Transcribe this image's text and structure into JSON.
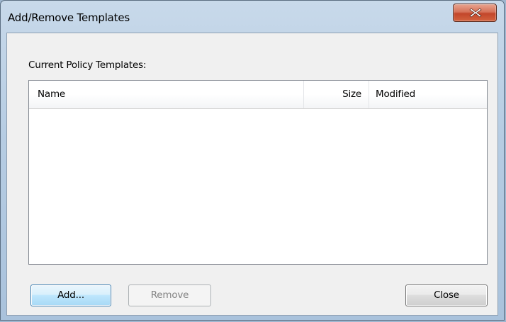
{
  "window": {
    "title": "Add/Remove Templates",
    "close_icon": "close-icon"
  },
  "dialog": {
    "templates_label": "Current Policy Templates:",
    "list": {
      "columns": [
        "Name",
        "Size",
        "Modified"
      ],
      "rows": []
    },
    "buttons": {
      "add_label": "Add...",
      "remove_label": "Remove",
      "close_label": "Close"
    }
  },
  "colors": {
    "accent_button_border": "#3c7fb1",
    "close_button": "#c2462a",
    "frame": "#b7cde3"
  }
}
